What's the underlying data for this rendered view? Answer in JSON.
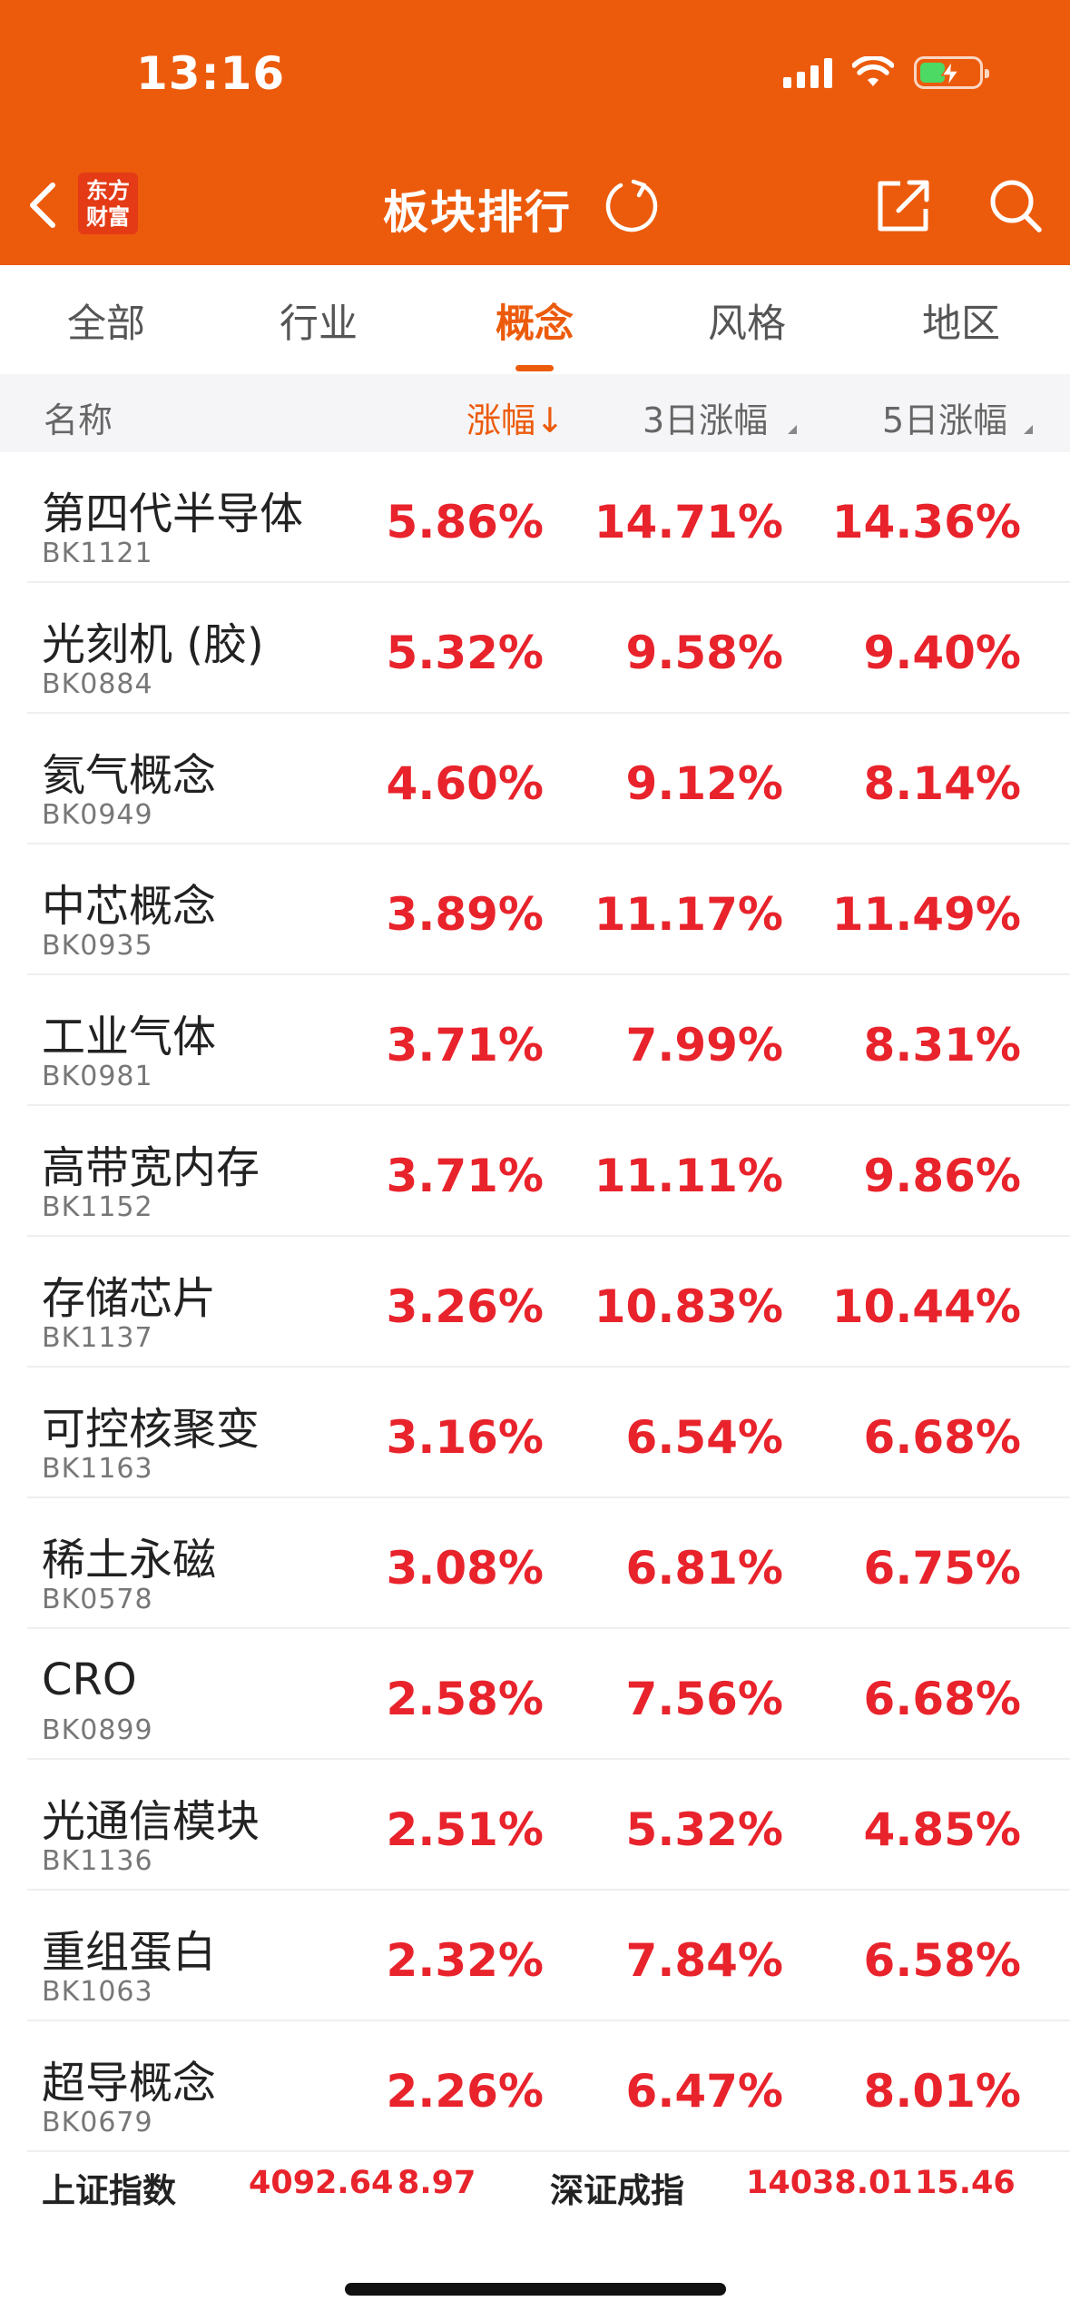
{
  "status_bar": {
    "time": "13:16"
  },
  "nav": {
    "logo_line1": "东方",
    "logo_line2": "财富",
    "title": "板块排行"
  },
  "tabs": [
    {
      "label": "全部",
      "active": false
    },
    {
      "label": "行业",
      "active": false
    },
    {
      "label": "概念",
      "active": true
    },
    {
      "label": "风格",
      "active": false
    },
    {
      "label": "地区",
      "active": false
    }
  ],
  "columns": {
    "name": "名称",
    "change": "涨幅↓",
    "change_3d": "3日涨幅",
    "change_5d": "5日涨幅"
  },
  "rows": [
    {
      "name": "第四代半导体",
      "code": "BK1121",
      "change": "5.86%",
      "change_3d": "14.71%",
      "change_5d": "14.36%"
    },
    {
      "name": "光刻机 (胶)",
      "code": "BK0884",
      "change": "5.32%",
      "change_3d": "9.58%",
      "change_5d": "9.40%"
    },
    {
      "name": "氦气概念",
      "code": "BK0949",
      "change": "4.60%",
      "change_3d": "9.12%",
      "change_5d": "8.14%"
    },
    {
      "name": "中芯概念",
      "code": "BK0935",
      "change": "3.89%",
      "change_3d": "11.17%",
      "change_5d": "11.49%"
    },
    {
      "name": "工业气体",
      "code": "BK0981",
      "change": "3.71%",
      "change_3d": "7.99%",
      "change_5d": "8.31%"
    },
    {
      "name": "高带宽内存",
      "code": "BK1152",
      "change": "3.71%",
      "change_3d": "11.11%",
      "change_5d": "9.86%"
    },
    {
      "name": "存储芯片",
      "code": "BK1137",
      "change": "3.26%",
      "change_3d": "10.83%",
      "change_5d": "10.44%"
    },
    {
      "name": "可控核聚变",
      "code": "BK1163",
      "change": "3.16%",
      "change_3d": "6.54%",
      "change_5d": "6.68%"
    },
    {
      "name": "稀土永磁",
      "code": "BK0578",
      "change": "3.08%",
      "change_3d": "6.81%",
      "change_5d": "6.75%"
    },
    {
      "name": "CRO",
      "code": "BK0899",
      "change": "2.58%",
      "change_3d": "7.56%",
      "change_5d": "6.68%"
    },
    {
      "name": "光通信模块",
      "code": "BK1136",
      "change": "2.51%",
      "change_3d": "5.32%",
      "change_5d": "4.85%"
    },
    {
      "name": "重组蛋白",
      "code": "BK1063",
      "change": "2.32%",
      "change_3d": "7.84%",
      "change_5d": "6.58%"
    },
    {
      "name": "超导概念",
      "code": "BK0679",
      "change": "2.26%",
      "change_3d": "6.47%",
      "change_5d": "8.01%"
    }
  ],
  "indices": [
    {
      "name": "上证指数",
      "value": "4092.64",
      "change": "8.97"
    },
    {
      "name": "深证成指",
      "value": "14038.01",
      "change": "15.46"
    }
  ],
  "colors": {
    "brand_orange": "#ec5b0c",
    "up_red": "#e8232b",
    "battery_green": "#4cd964"
  }
}
